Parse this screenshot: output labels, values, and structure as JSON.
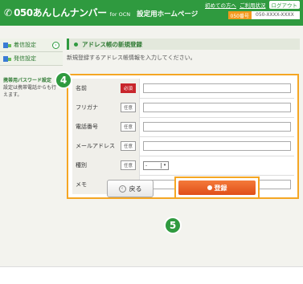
{
  "header": {
    "brand": "050あんしんナンバー",
    "for_label": "for OCN",
    "page_title": "設定用ホームページ",
    "links": [
      "初めての方へ",
      "ご利用状況"
    ],
    "logout": "ログアウト",
    "number_label": "050番号",
    "number_value": "050-XXXX-XXXX"
  },
  "sidebar": {
    "items": [
      {
        "label": "着信設定"
      },
      {
        "label": "発信設定"
      }
    ],
    "note_title": "携帯用パスワード設定",
    "note_text": "設定は携帯電話からも行えます。"
  },
  "main": {
    "section_title": "アドレス帳の新規登録",
    "hint": "新規登録するアドレス帳情報を入力してください。",
    "rows": [
      {
        "label": "名前",
        "badge": "必須"
      },
      {
        "label": "フリガナ",
        "badge": "任意"
      },
      {
        "label": "電話番号",
        "badge": "任意"
      },
      {
        "label": "メールアドレス",
        "badge": "任意"
      },
      {
        "label": "種別",
        "badge": "任意"
      },
      {
        "label": "メモ",
        "badge": "任意"
      }
    ],
    "select_value": "-",
    "back_button": "戻る",
    "register_button": "登録",
    "step_form": "4",
    "step_button": "5"
  }
}
